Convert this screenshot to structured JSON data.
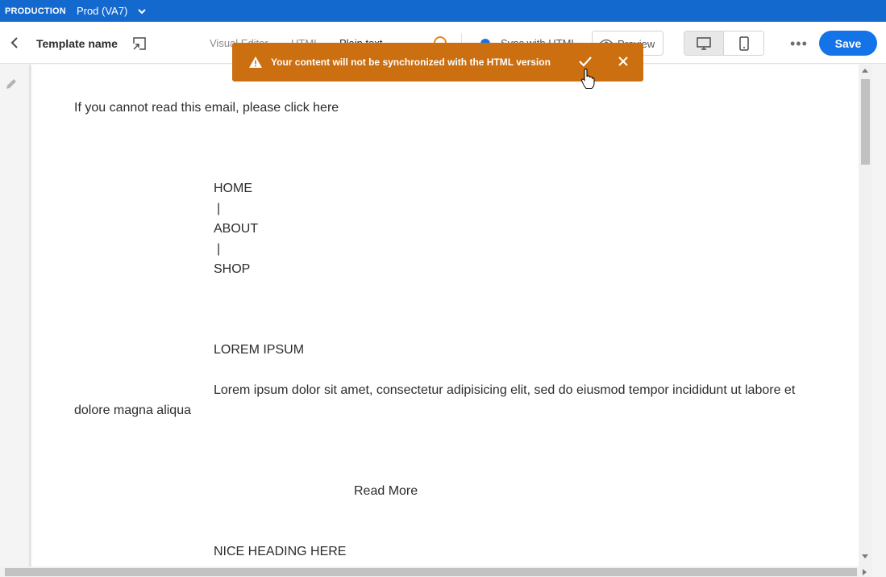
{
  "topbar": {
    "env_label": "PRODUCTION",
    "env_name": "Prod (VA7)"
  },
  "toolbar": {
    "template_name": "Template name",
    "tabs": [
      "Visual Editor",
      "HTML",
      "Plain text"
    ],
    "sync_label": "Sync with HTML",
    "preview_label": "Preview",
    "save_label": "Save"
  },
  "toast": {
    "message": "Your content will not be synchronized with the HTML version"
  },
  "content": {
    "lines": [
      "If you cannot read this email, please  click here",
      "HOME",
      "|",
      "ABOUT",
      "|",
      "SHOP",
      "LOREM IPSUM",
      "Lorem ipsum dolor sit amet, consectetur adipisicing elit, sed do eiusmod tempor incididunt ut labore et",
      "dolore magna aliqua",
      "Read More",
      "NICE HEADING HERE"
    ]
  },
  "colors": {
    "brand_blue": "#1469ce",
    "accent_blue": "#1473e6",
    "warning_orange": "#cb6f10"
  },
  "icons": [
    "chevron-down-icon",
    "back-arrow-icon",
    "expand-icon",
    "warning-icon",
    "eye-icon",
    "desktop-icon",
    "mobile-icon",
    "more-icon",
    "check-icon",
    "close-icon",
    "pencil-icon",
    "hand-cursor-icon"
  ]
}
